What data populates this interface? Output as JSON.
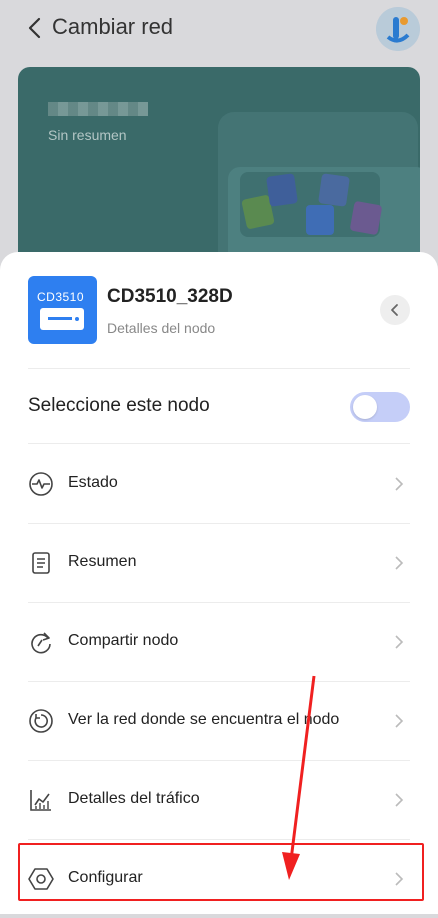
{
  "header": {
    "title": "Cambiar red"
  },
  "card": {
    "subtitle": "Sin resumen"
  },
  "node": {
    "icon_label": "CD3510",
    "name": "CD3510_328D",
    "subtitle": "Detalles del nodo"
  },
  "select_node": {
    "label": "Seleccione este nodo",
    "enabled": false
  },
  "menu": [
    {
      "label": "Estado",
      "icon": "pulse-icon"
    },
    {
      "label": "Resumen",
      "icon": "document-icon"
    },
    {
      "label": "Compartir nodo",
      "icon": "share-icon"
    },
    {
      "label": "Ver la red donde se encuentra el nodo",
      "icon": "network-icon"
    },
    {
      "label": "Detalles del tráfico",
      "icon": "chart-icon"
    },
    {
      "label": "Configurar",
      "icon": "hexagon-settings-icon"
    }
  ],
  "colors": {
    "accent": "#2e7ff0",
    "toggle": "#c5cef8",
    "highlight": "#f02020"
  }
}
